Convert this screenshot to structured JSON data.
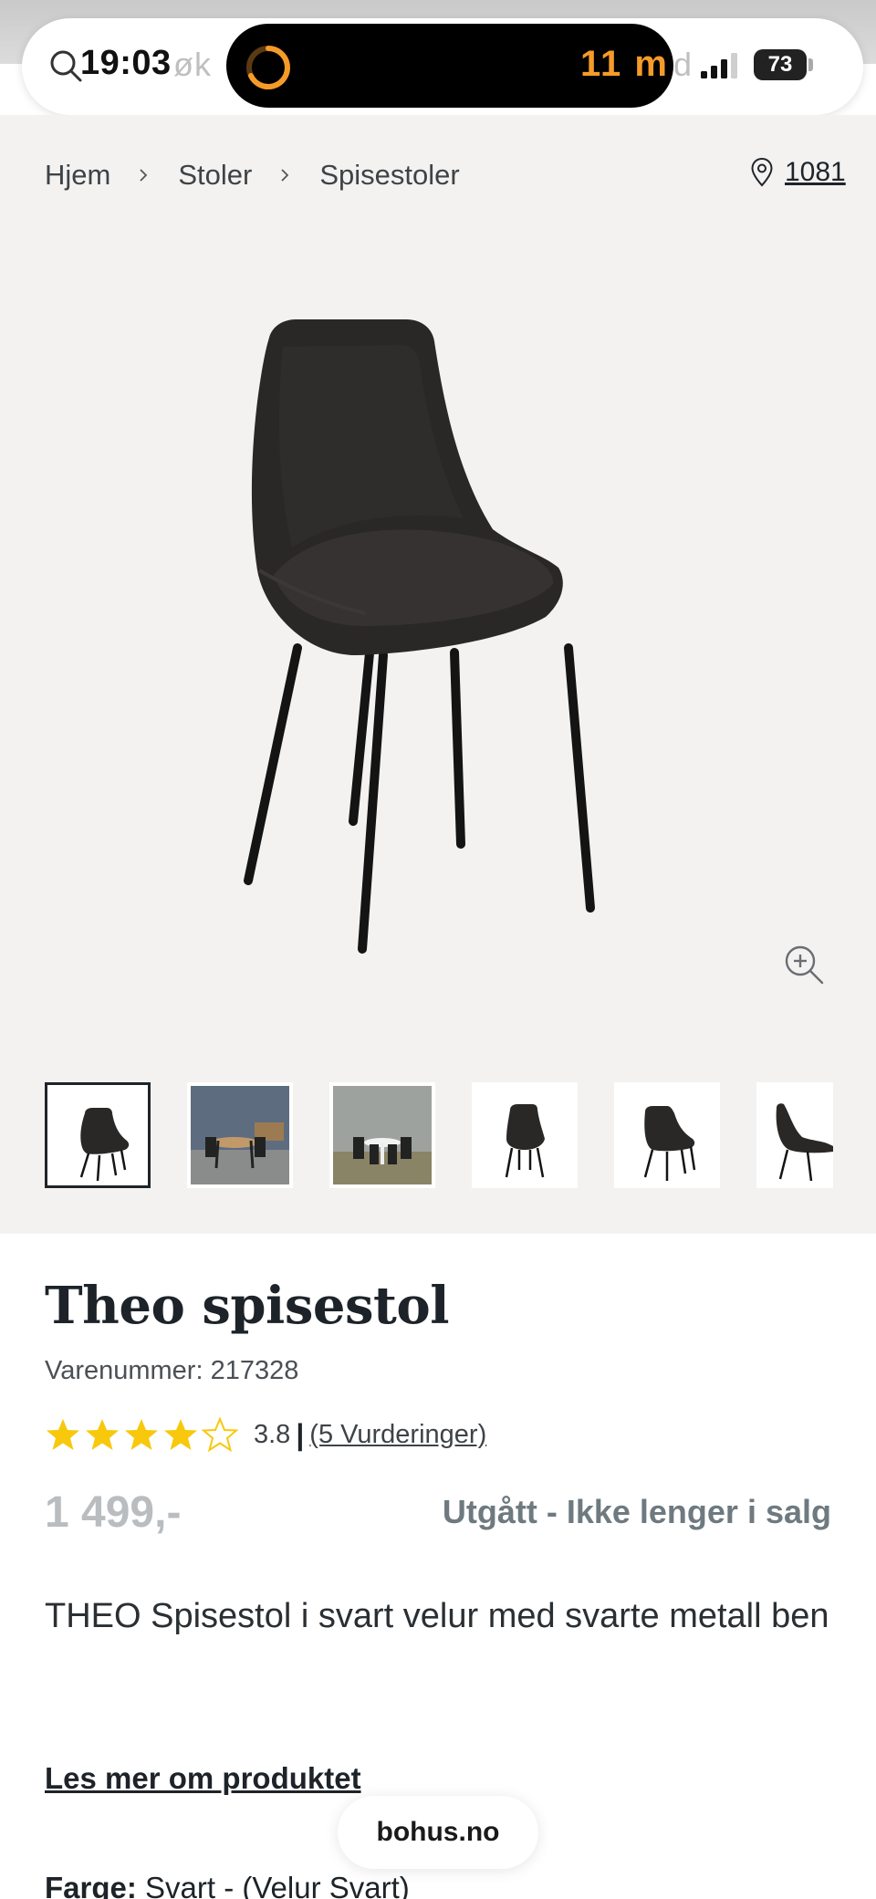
{
  "status_bar": {
    "time": "19:03",
    "timer": "11 m",
    "battery": "73"
  },
  "url_bar": {
    "text_left": "øk",
    "text_right": "d"
  },
  "breadcrumb": [
    "Hjem",
    "Stoler",
    "Spisestoler"
  ],
  "store": "1081",
  "product": {
    "title": "Theo spisestol",
    "sku": "Varenummer: 217328",
    "rating_value": "3.8",
    "rating_count": "(5 Vurderinger)",
    "stars_filled": 4,
    "stars_total": 5,
    "price": "1 499,-",
    "availability": "Utgått - Ikke lenger i salg",
    "description": "THEO Spisestol i svart velur med svarte metall ben",
    "read_more": "Les mer om produktet",
    "color_label": "Farge:",
    "color_value": "Svart - (Velur Svart)"
  },
  "site_pill": "bohus.no",
  "colors": {
    "star": "#f8c80c",
    "gallery_bg": "#f3f2f1",
    "price_disabled": "#b9bdc0",
    "availability": "#6e7a80"
  }
}
